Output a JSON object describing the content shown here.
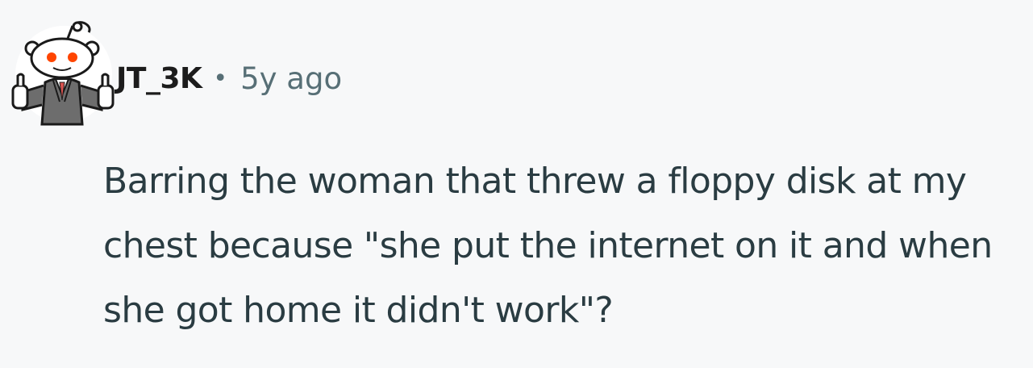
{
  "comment": {
    "author": "JT_3K",
    "separator": "•",
    "timestamp": "5y ago",
    "avatar_icon": "reddit-snoo-suit-avatar",
    "body": "Barring the woman that threw a floppy disk at my chest because \"she put the internet on it and when she got home it didn't work\"?"
  },
  "colors": {
    "background": "#f7f8f9",
    "username": "#1c1c1c",
    "meta": "#576f76",
    "body": "#2a3c42",
    "snoo_eyes": "#ff4500",
    "suit": "#6d6d6d"
  }
}
